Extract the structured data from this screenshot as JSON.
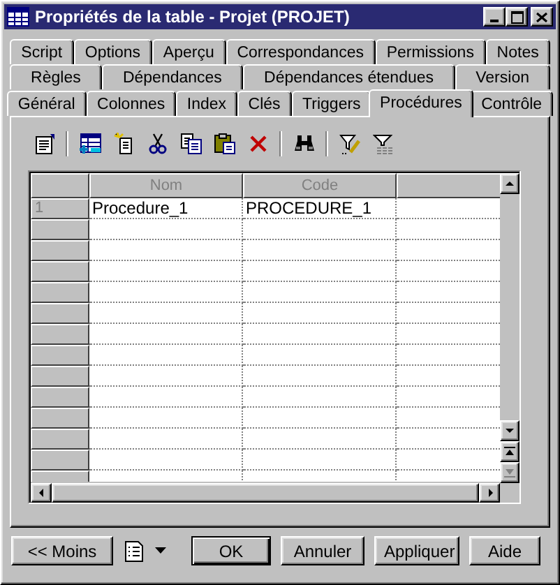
{
  "window": {
    "title": "Propriétés de la table - Projet (PROJET)"
  },
  "tab_rows": [
    [
      {
        "label": "Script",
        "selected": false
      },
      {
        "label": "Options",
        "selected": false
      },
      {
        "label": "Aperçu",
        "selected": false
      },
      {
        "label": "Correspondances",
        "selected": false
      },
      {
        "label": "Permissions",
        "selected": false
      },
      {
        "label": "Notes",
        "selected": false
      }
    ],
    [
      {
        "label": "Règles",
        "selected": false
      },
      {
        "label": "Dépendances",
        "selected": false
      },
      {
        "label": "Dépendances étendues",
        "selected": false
      },
      {
        "label": "Version",
        "selected": false
      }
    ],
    [
      {
        "label": "Général",
        "selected": false
      },
      {
        "label": "Colonnes",
        "selected": false
      },
      {
        "label": "Index",
        "selected": false
      },
      {
        "label": "Clés",
        "selected": false
      },
      {
        "label": "Triggers",
        "selected": false
      },
      {
        "label": "Procédures",
        "selected": true
      },
      {
        "label": "Contrôle",
        "selected": false
      }
    ]
  ],
  "grid": {
    "columns": [
      "Nom",
      "Code"
    ],
    "rows": [
      {
        "number": "1",
        "cells": [
          "Procedure_1",
          "PROCEDURE_1"
        ]
      }
    ]
  },
  "footer": {
    "left_button": "<< Moins",
    "buttons": [
      {
        "label": "OK",
        "default": true
      },
      {
        "label": "Annuler",
        "default": false
      },
      {
        "label": "Appliquer",
        "default": false
      },
      {
        "label": "Aide",
        "default": false
      }
    ]
  }
}
